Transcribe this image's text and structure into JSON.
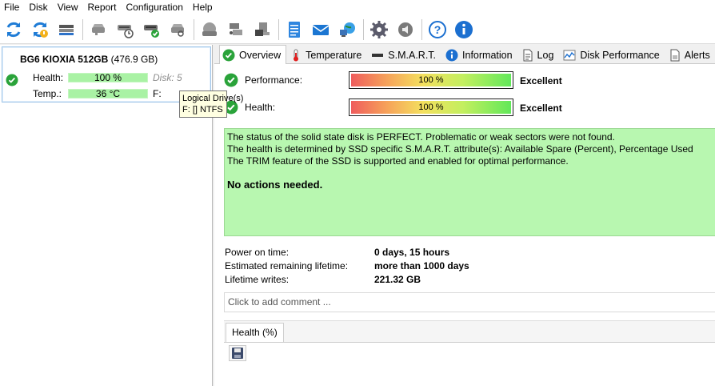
{
  "menu": [
    {
      "label": "File"
    },
    {
      "label": "Disk"
    },
    {
      "label": "View"
    },
    {
      "label": "Report"
    },
    {
      "label": "Configuration"
    },
    {
      "label": "Help"
    }
  ],
  "drive": {
    "name": "BG6 KIOXIA 512GB",
    "size": "(476.9 GB)",
    "health_label": "Health:",
    "health_value": "100 %",
    "health_fraction": 1.0,
    "disk": "Disk: 5",
    "temp_label": "Temp.:",
    "temp_value": "36 °C",
    "drive_letter": "F:"
  },
  "tooltip": {
    "line1": "Logical Drive(s)",
    "line2": "F: [] NTFS"
  },
  "tabs": [
    {
      "label": "Overview",
      "icon": "check-icon"
    },
    {
      "label": "Temperature",
      "icon": "thermometer-icon"
    },
    {
      "label": "S.M.A.R.T.",
      "icon": "disk-icon"
    },
    {
      "label": "Information",
      "icon": "info-icon"
    },
    {
      "label": "Log",
      "icon": "document-icon"
    },
    {
      "label": "Disk Performance",
      "icon": "chart-icon"
    },
    {
      "label": "Alerts",
      "icon": "alert-icon"
    }
  ],
  "overview": {
    "performance_label": "Performance:",
    "performance_value": "100 %",
    "performance_fraction": 1.0,
    "performance_rating": "Excellent",
    "health_label": "Health:",
    "health_value": "100 %",
    "health_fraction": 1.0,
    "health_rating": "Excellent",
    "status_lines": [
      "The status of the solid state disk is PERFECT. Problematic or weak sectors were not found.",
      "The health is determined by SSD specific S.M.A.R.T. attribute(s):  Available Spare (Percent), Percentage Used",
      "The TRIM feature of the SSD is supported and enabled for optimal performance."
    ],
    "status_action": "No actions needed.",
    "power_on_label": "Power on time:",
    "power_on_value": "0 days, 15 hours",
    "lifetime_label": "Estimated remaining lifetime:",
    "lifetime_value": "more than 1000 days",
    "writes_label": "Lifetime writes:",
    "writes_value": "221.32 GB",
    "comment_placeholder": "Click to add comment ...",
    "bottom_tab": "Health (%)"
  },
  "colors": {
    "status_bg": "#b8f7b0",
    "bar_green": "#a9f2a4",
    "accent_blue": "#0a6fd8"
  }
}
